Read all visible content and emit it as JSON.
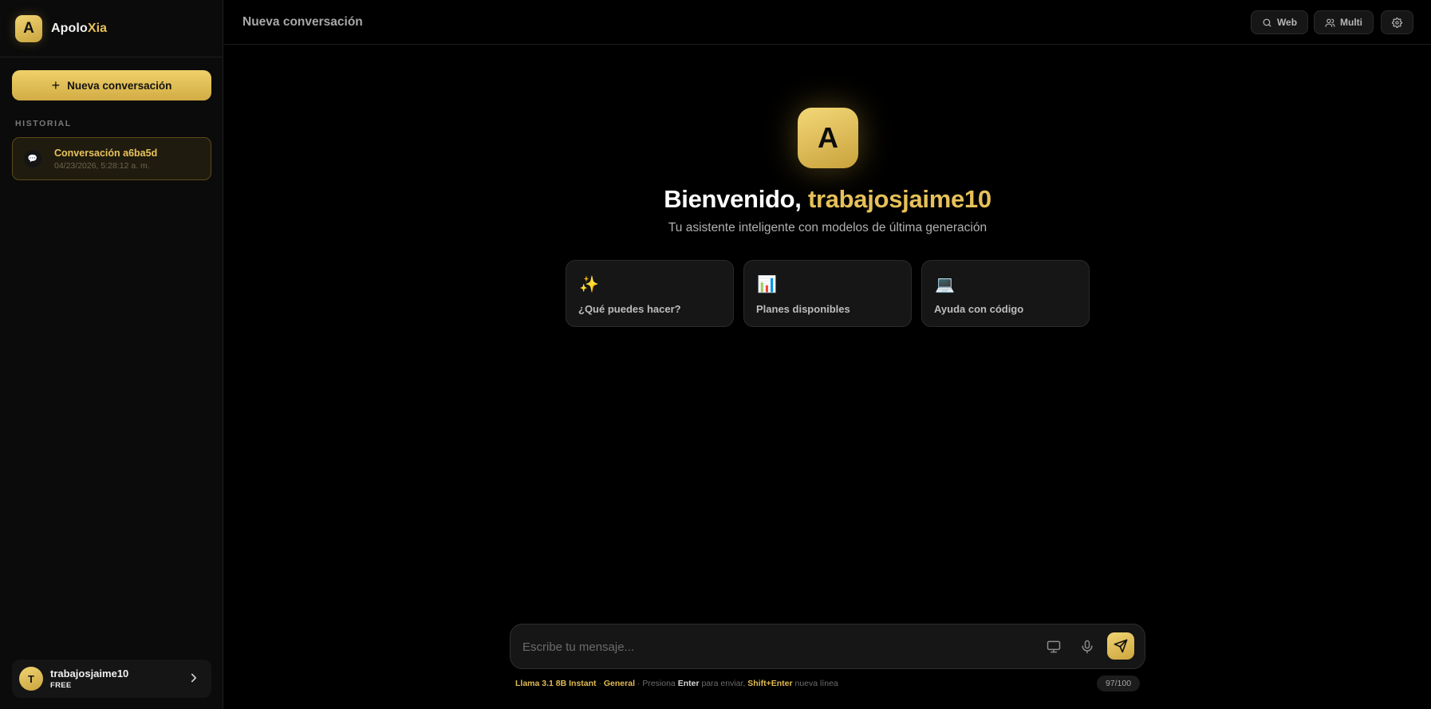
{
  "brand": {
    "logo_letter": "A",
    "name_part1": "Apolo",
    "name_part2": "Xia"
  },
  "sidebar": {
    "new_chat_label": "Nueva conversación",
    "history_title": "HISTORIAL",
    "conversations": [
      {
        "icon": "speech-bubble-icon",
        "title": "Conversación a6ba5d",
        "date": "04/23/2026, 5:28:12 a. m.",
        "active": true
      }
    ],
    "user": {
      "initial": "T",
      "name": "trabajosjaime10",
      "plan": "FREE"
    }
  },
  "header": {
    "title": "Nueva conversación",
    "web_label": "Web",
    "multi_label": "Multi"
  },
  "hero": {
    "logo_letter": "A",
    "greeting": "Bienvenido,",
    "username": "trabajosjaime10",
    "subtitle": "Tu asistente inteligente con modelos de última generación"
  },
  "suggestions": [
    {
      "icon": "✨",
      "label": "¿Qué puedes hacer?"
    },
    {
      "icon": "📊",
      "label": "Planes disponibles"
    },
    {
      "icon": "💻",
      "label": "Ayuda con código"
    }
  ],
  "composer": {
    "placeholder": "Escribe tu mensaje...",
    "value": ""
  },
  "hint": {
    "model": "Llama 3.1 8B Instant",
    "sep1": " · ",
    "mode": "General",
    "sep2": " · Presiona ",
    "enter_key": "Enter",
    "enter_text": " para enviar, ",
    "newline_key": "Shift+Enter",
    "newline_text": " nueva línea"
  },
  "counter": "97/100",
  "colors": {
    "accent": "#e6c159",
    "background": "#000000",
    "sidebar": "#0b0b0b",
    "card": "#161616"
  }
}
